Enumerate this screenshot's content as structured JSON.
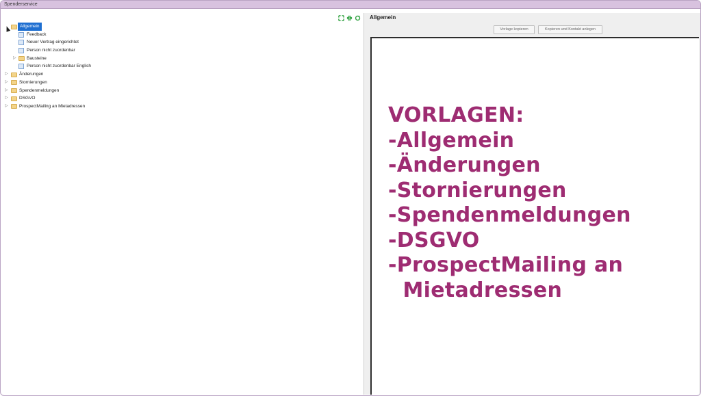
{
  "window": {
    "title": "Spenderservice"
  },
  "tree": {
    "items": [
      {
        "label": "Allgemein",
        "type": "folder",
        "level": 0,
        "selected": true,
        "expander": ""
      },
      {
        "label": "Feedback",
        "type": "doc",
        "level": 1
      },
      {
        "label": "Neuer Vertrag eingerichtet",
        "type": "doc",
        "level": 1
      },
      {
        "label": "Person nicht zuordenbar",
        "type": "doc",
        "level": 1
      },
      {
        "label": "Bausteine",
        "type": "folder",
        "level": 1,
        "expander": "▷"
      },
      {
        "label": "Person nicht zuordenbar English",
        "type": "doc",
        "level": 1
      },
      {
        "label": "Änderungen",
        "type": "folder",
        "level": 0,
        "expander": "▷"
      },
      {
        "label": "Stornierungen",
        "type": "folder",
        "level": 0,
        "expander": "▷"
      },
      {
        "label": "Spendenmeldungen",
        "type": "folder",
        "level": 0,
        "expander": "▷"
      },
      {
        "label": "DSGVO",
        "type": "folder",
        "level": 0,
        "expander": "▷"
      },
      {
        "label": "ProspectMailing an Mietadressen",
        "type": "folder",
        "level": 0,
        "expander": "▷"
      }
    ]
  },
  "toolbar": {
    "icons": [
      "expand-icon",
      "collapse-icon",
      "refresh-icon"
    ],
    "accent": "#3aa64a"
  },
  "right": {
    "title": "Allgemein",
    "buttons": {
      "copy_template": "Vorlage kopieren",
      "copy_and_contact": "Kopieren und Kontakt anlegen"
    }
  },
  "overlay": {
    "color": "#9e2c72",
    "lines": [
      "VORLAGEN:",
      "-Allgemein",
      "-Änderungen",
      "-Stornierungen",
      "-Spendenmeldungen",
      "-DSGVO",
      "-ProspectMailing an",
      " Mietadressen"
    ]
  }
}
